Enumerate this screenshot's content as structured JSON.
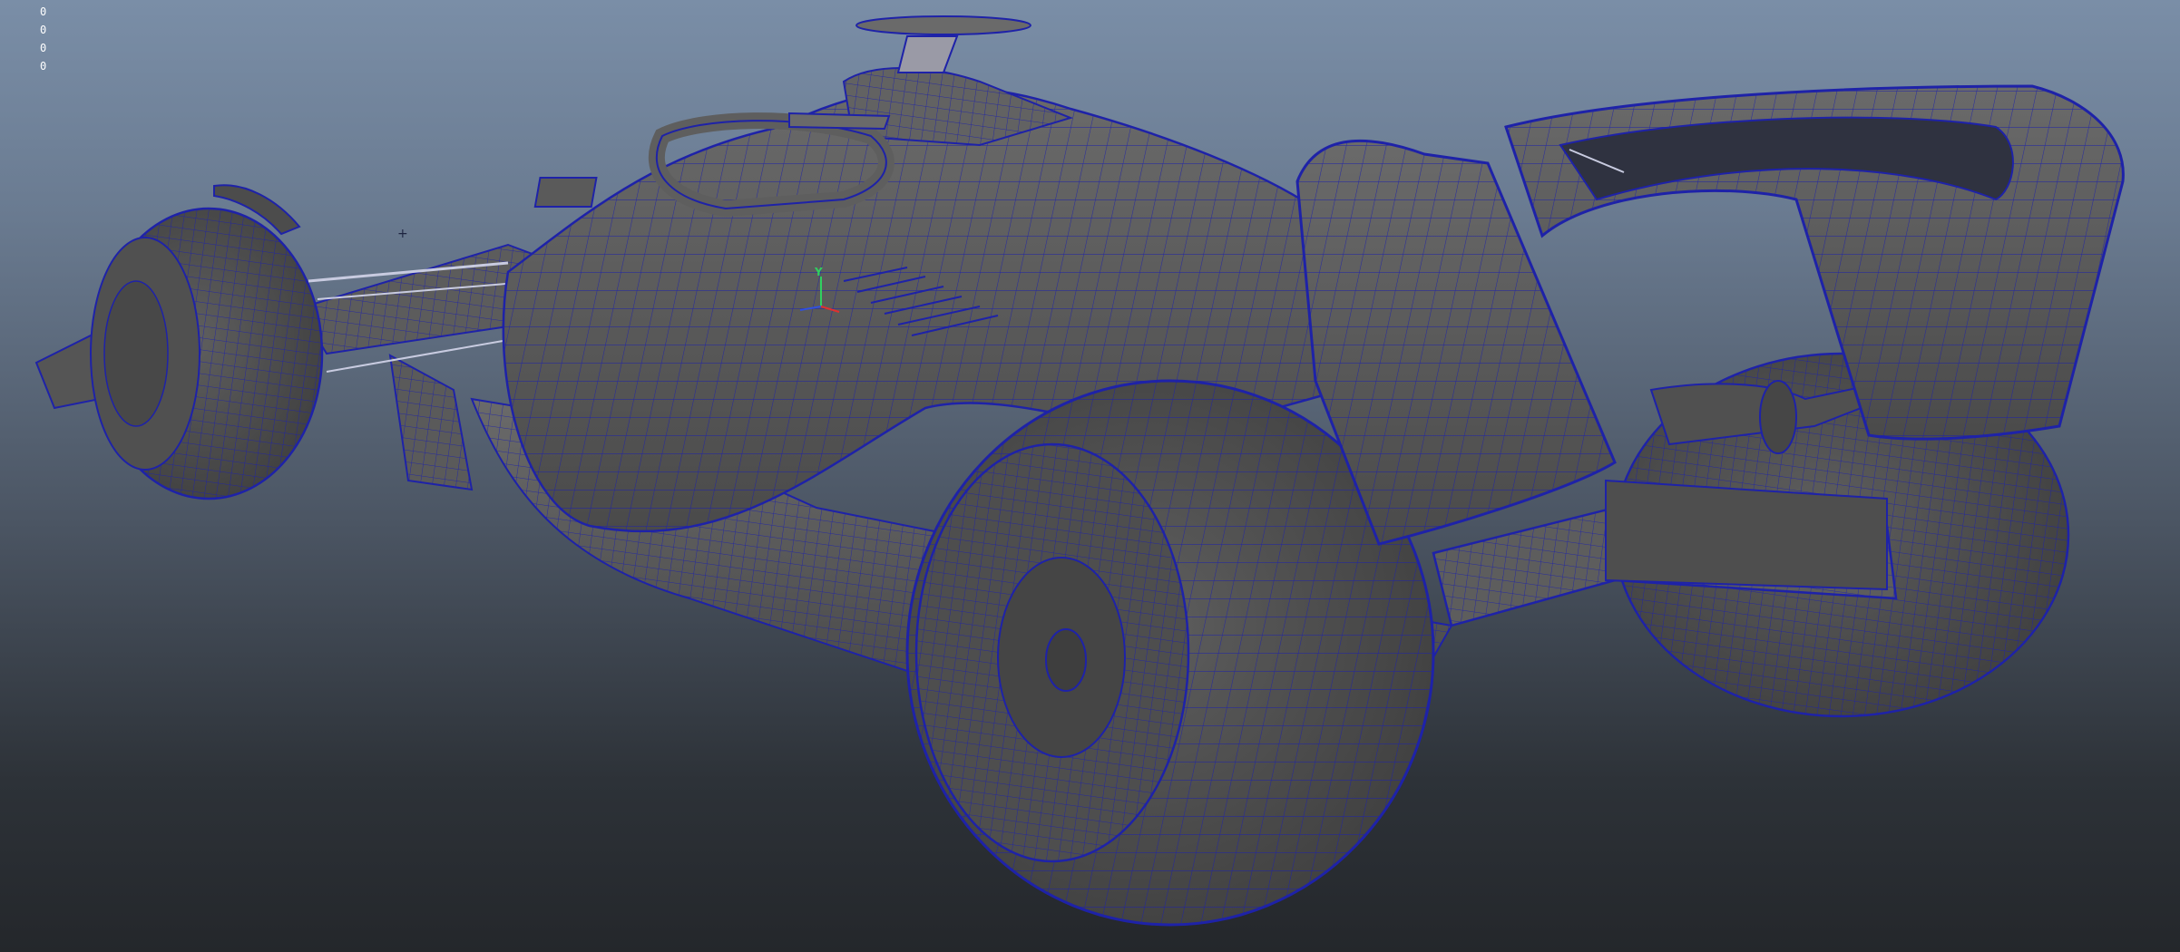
{
  "viewport": {
    "background_top": "#7a8ea7",
    "background_bottom": "#24272b",
    "wire_color": "#1e22a8",
    "surface_color": "#595959"
  },
  "hud": {
    "values": [
      "0",
      "0",
      "0",
      "0"
    ],
    "text_color": "#ffffff"
  },
  "view_axis": {
    "y_label": "Y",
    "x_color": "#e03030",
    "y_color": "#30d060",
    "z_color": "#3050e0"
  },
  "icons": {
    "cursor": "crosshair-icon"
  }
}
